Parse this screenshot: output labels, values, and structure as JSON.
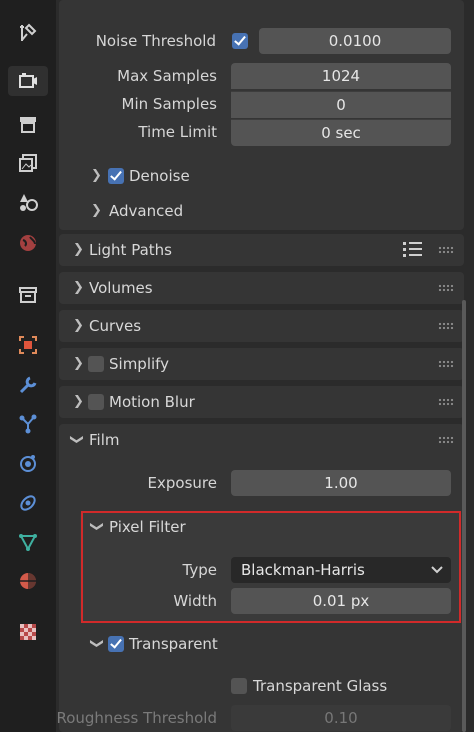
{
  "sampling": {
    "noise_threshold": {
      "label": "Noise Threshold",
      "value": "0.0100",
      "checked": true
    },
    "max_samples": {
      "label": "Max Samples",
      "value": "1024"
    },
    "min_samples": {
      "label": "Min Samples",
      "value": "0"
    },
    "time_limit": {
      "label": "Time Limit",
      "value": "0 sec"
    },
    "denoise": {
      "label": "Denoise",
      "checked": true
    },
    "advanced": {
      "label": "Advanced"
    }
  },
  "panels": {
    "light_paths": "Light Paths",
    "volumes": "Volumes",
    "curves": "Curves",
    "simplify": "Simplify",
    "motion_blur": "Motion Blur",
    "film": "Film"
  },
  "film": {
    "exposure": {
      "label": "Exposure",
      "value": "1.00"
    },
    "pixel_filter": {
      "label": "Pixel Filter",
      "type_label": "Type",
      "type_value": "Blackman-Harris",
      "width_label": "Width",
      "width_value": "0.01 px"
    },
    "transparent": {
      "label": "Transparent",
      "checked": true
    },
    "transparent_glass": {
      "label": "Transparent Glass",
      "checked": false
    },
    "roughness_threshold": {
      "label": "Roughness Threshold",
      "value": "0.10"
    }
  },
  "sidebar_icons": [
    "tool-icon",
    "render-icon",
    "output-icon",
    "view-layer-icon",
    "scene-icon",
    "world-icon",
    "collection-icon",
    "object-icon",
    "modifier-icon",
    "particles-icon",
    "physics-icon",
    "constraints-icon",
    "data-icon",
    "material-icon",
    "texture-icon"
  ],
  "colors": {
    "accent": "#4772b3",
    "highlight": "#d12a2a"
  }
}
